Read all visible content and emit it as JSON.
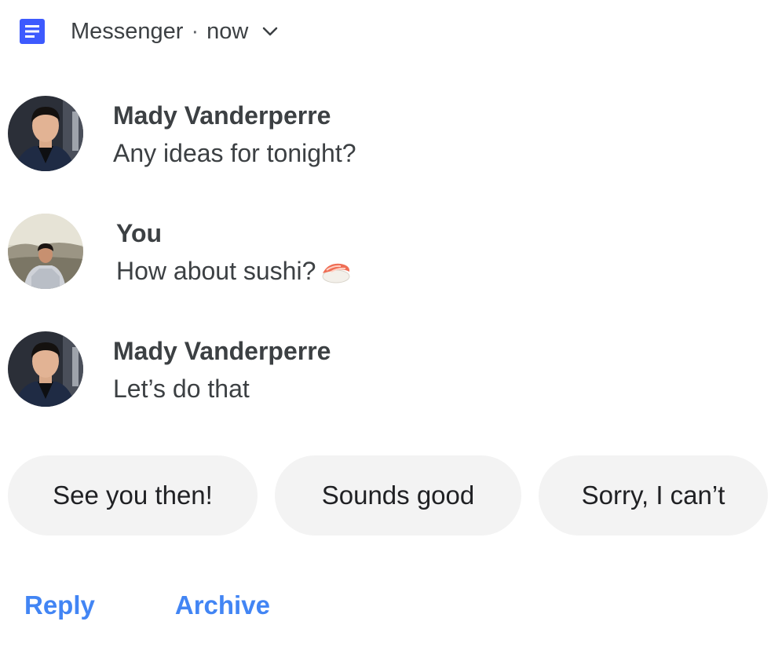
{
  "header": {
    "app_name": "Messenger",
    "separator": "·",
    "time": "now",
    "app_icon": "messages-app-icon",
    "expand_icon": "chevron-down-icon",
    "accent": "#3d5afe"
  },
  "messages": [
    {
      "sender": "Mady Vanderperre",
      "text": "Any ideas for tonight?",
      "avatar": "mady-avatar"
    },
    {
      "sender": "You",
      "text": "How about sushi?",
      "emoji": "sushi-emoji",
      "avatar": "you-avatar"
    },
    {
      "sender": "Mady Vanderperre",
      "text": "Let’s do that",
      "avatar": "mady-avatar"
    }
  ],
  "smart_replies": [
    "See you then!",
    "Sounds good",
    "Sorry, I can’t"
  ],
  "actions": {
    "reply": "Reply",
    "archive": "Archive",
    "color": "#4285f4"
  }
}
